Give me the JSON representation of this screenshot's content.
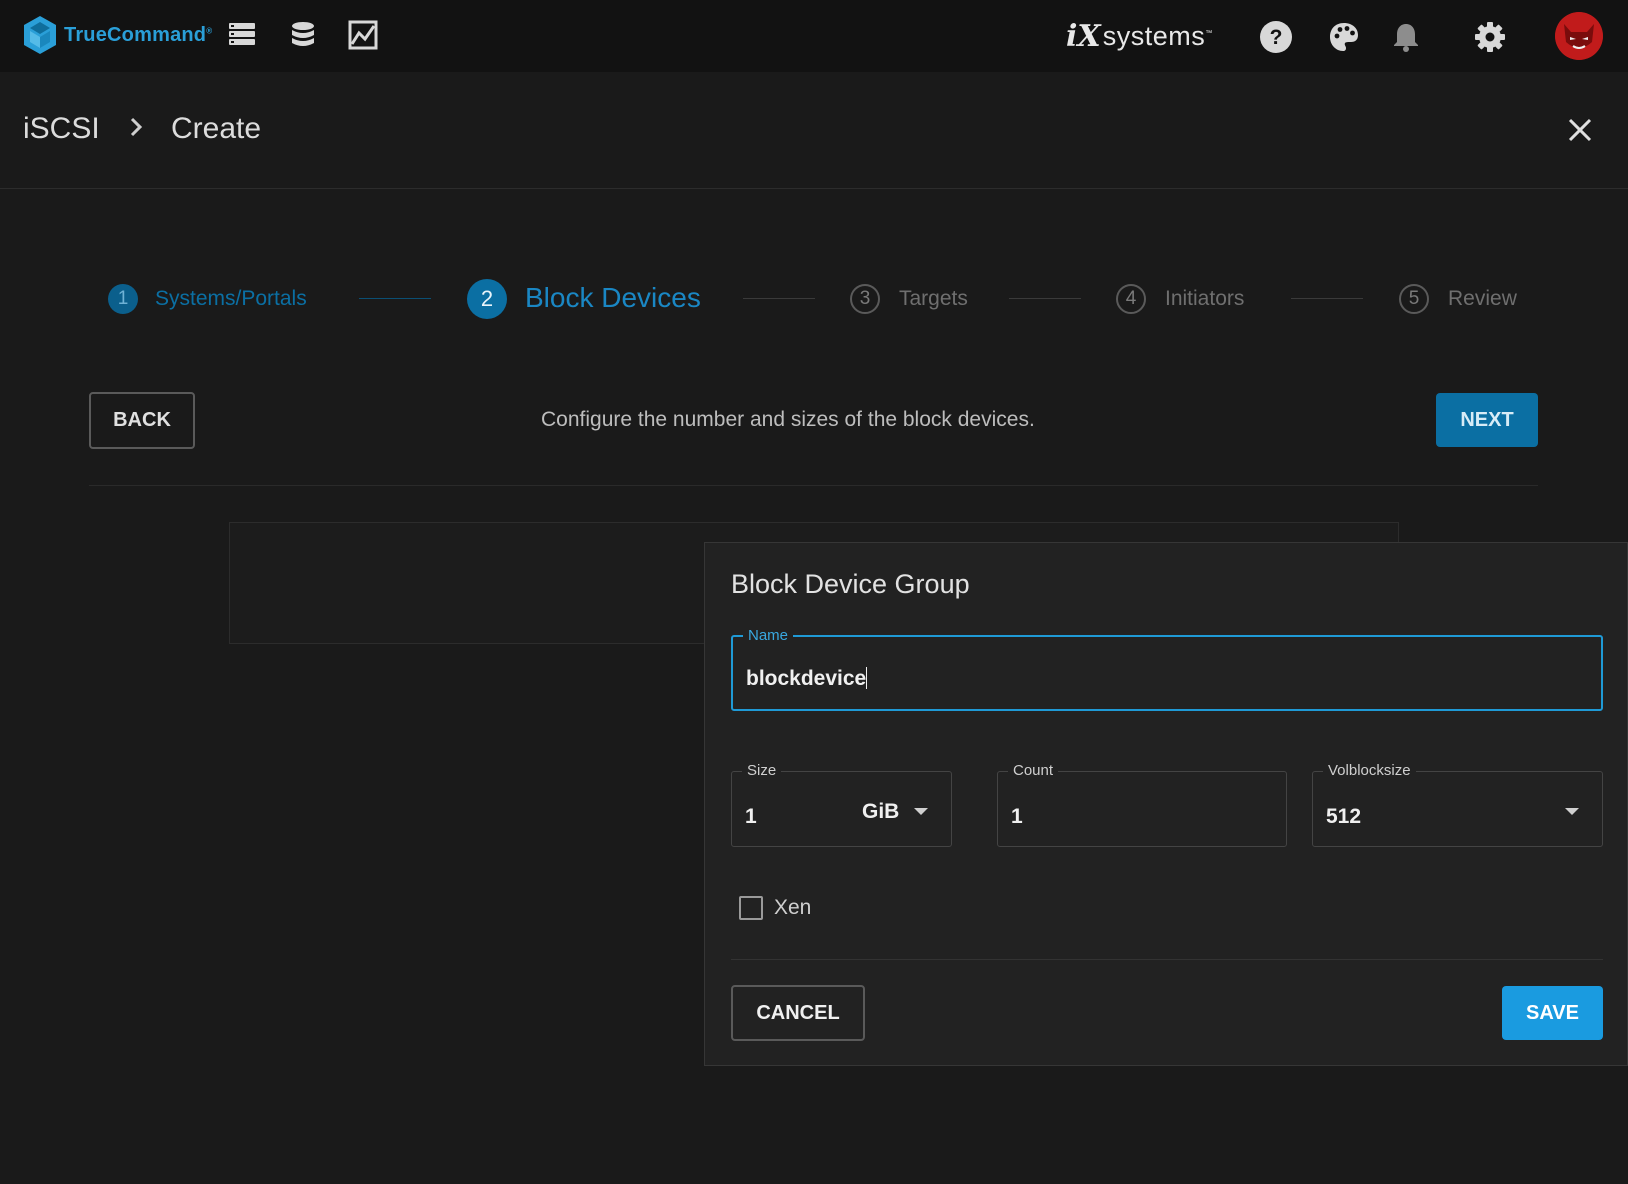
{
  "topbar": {
    "logo_text": "TrueCommand",
    "logo_mark": "®",
    "nav_icons": [
      "systems-icon",
      "storage-icon",
      "reports-icon"
    ],
    "brand_mark": "iX",
    "brand_word": "systems",
    "brand_tm": "™",
    "actions": [
      "help-icon",
      "palette-icon",
      "bell-icon",
      "gear-icon",
      "avatar"
    ]
  },
  "header": {
    "crumb_root": "iSCSI",
    "crumb_current": "Create"
  },
  "stepper": {
    "steps": [
      {
        "number": "1",
        "label": "Systems/Portals"
      },
      {
        "number": "2",
        "label": "Block Devices"
      },
      {
        "number": "3",
        "label": "Targets"
      },
      {
        "number": "4",
        "label": "Initiators"
      },
      {
        "number": "5",
        "label": "Review"
      }
    ]
  },
  "step_actions": {
    "back_label": "BACK",
    "next_label": "NEXT",
    "instruction": "Configure the number and sizes of the block devices."
  },
  "dialog": {
    "title": "Block Device Group",
    "name_label": "Name",
    "name_value": "blockdevice",
    "size_label": "Size",
    "size_value": "1",
    "size_unit": "GiB",
    "count_label": "Count",
    "count_value": "1",
    "volblocksize_label": "Volblocksize",
    "volblocksize_value": "512",
    "xen_label": "Xen",
    "xen_checked": false,
    "cancel_label": "CANCEL",
    "save_label": "SAVE"
  },
  "colors": {
    "accent": "#1f9ad6",
    "step_active": "#0b6fa3",
    "step_done": "#0b5f8c"
  }
}
